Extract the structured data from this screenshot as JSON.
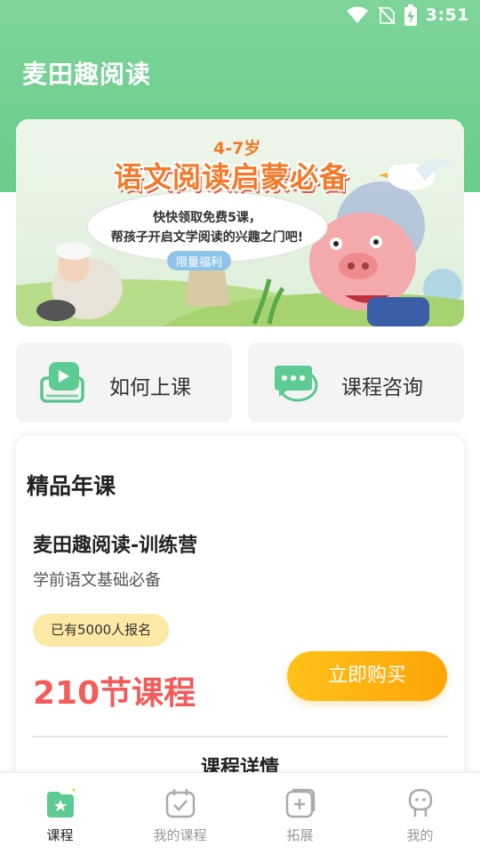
{
  "status_bar": {
    "time": "3:51"
  },
  "app": {
    "title": "麦田趣阅读"
  },
  "banner": {
    "age": "4-7岁",
    "headline": "语文阅读启蒙必备",
    "line1": "快快领取免费5课，",
    "line2": "帮孩子开启文学阅读的兴趣之门吧!",
    "tag": "限量福利"
  },
  "quick_actions": [
    {
      "label": "如何上课",
      "icon": "video-lesson-icon"
    },
    {
      "label": "课程咨询",
      "icon": "chat-bubble-icon"
    }
  ],
  "featured": {
    "section_title": "精品年课",
    "course_name": "麦田趣阅读-训练营",
    "course_subtitle": "学前语文基础必备",
    "enroll_badge": "已有5000人报名",
    "lesson_count": "210节课程",
    "buy_label": "立即购买",
    "detail_label": "课程详情"
  },
  "tabs": [
    {
      "label": "课程",
      "icon": "course-star-icon",
      "active": true
    },
    {
      "label": "我的课程",
      "icon": "calendar-check-icon",
      "active": false
    },
    {
      "label": "拓展",
      "icon": "add-square-icon",
      "active": false
    },
    {
      "label": "我的",
      "icon": "user-avatar-icon",
      "active": false
    }
  ],
  "colors": {
    "header_green": "#6fd08f",
    "accent_red": "#f45b5b",
    "accent_orange": "#ffa406",
    "badge_yellow": "#fde9a6"
  }
}
